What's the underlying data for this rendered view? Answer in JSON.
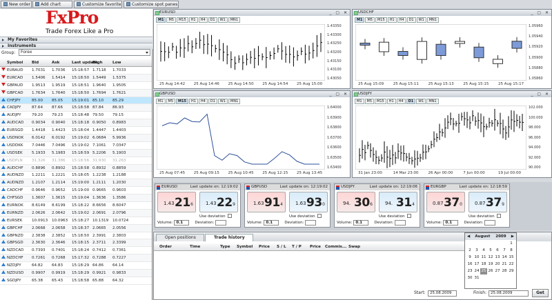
{
  "toolbar": {
    "buttons": [
      "New order",
      "Add chart",
      "Customize favorites",
      "Customize spot panes"
    ]
  },
  "brand": {
    "logo": "FxPro",
    "tagline": "Trade Forex Like a Pro"
  },
  "sidebar": {
    "favorites": "My Favorites",
    "instruments": "Instruments",
    "group_label": "Group:",
    "group_value": "Forex"
  },
  "market": {
    "headers": [
      "Symbol",
      "Bid",
      "Ask",
      "Last update",
      "High",
      "Low"
    ],
    "rows": [
      {
        "dir": "dn",
        "s": "EURAUD",
        "b": "1.7031",
        "a": "1.7036",
        "t": "15:18:57",
        "h": "1.7118",
        "l": "1.7033"
      },
      {
        "dir": "dn",
        "s": "EURCAD",
        "b": "1.5406",
        "a": "1.5414",
        "t": "15:18:50",
        "h": "1.5449",
        "l": "1.5375"
      },
      {
        "dir": "dn",
        "s": "GBPAUD",
        "b": "1.9513",
        "a": "1.9519",
        "t": "15:18:51",
        "h": "1.9640",
        "l": "1.9505"
      },
      {
        "dir": "dn",
        "s": "GBPCAD",
        "b": "1.7634",
        "a": "1.7640",
        "t": "15:18:50",
        "h": "1.7694",
        "l": "1.7621"
      },
      {
        "dir": "up",
        "s": "CHFJPY",
        "b": "85.00",
        "a": "85.05",
        "t": "15:19:01",
        "h": "85.10",
        "l": "85.29",
        "sel": true
      },
      {
        "dir": "up",
        "s": "CADJPY",
        "b": "87.64",
        "a": "87.66",
        "t": "15:18:58",
        "h": "87.84",
        "l": "86.93"
      },
      {
        "dir": "up",
        "s": "AUDJPY",
        "b": "79.20",
        "a": "79.23",
        "t": "15:18:48",
        "h": "79.50",
        "l": "79.15"
      },
      {
        "dir": "up",
        "s": "AUDCAD",
        "b": "0.9034",
        "a": "0.9040",
        "t": "15:18:18",
        "h": "0.9050",
        "l": "0.8983"
      },
      {
        "dir": "up",
        "s": "EURSGD",
        "b": "1.4418",
        "a": "1.4423",
        "t": "15:18:04",
        "h": "1.4447",
        "l": "1.4403"
      },
      {
        "dir": "up",
        "s": "USDNOK",
        "b": "6.0142",
        "a": "6.0192",
        "t": "15:19:02",
        "h": "6.0684",
        "l": "5.9936"
      },
      {
        "dir": "up",
        "s": "USDDKK",
        "b": "7.0446",
        "a": "7.0496",
        "t": "15:19:02",
        "h": "7.1061",
        "l": "7.0347"
      },
      {
        "dir": "up",
        "s": "USDSEK",
        "b": "5.1933",
        "a": "5.1983",
        "t": "15:18:59",
        "h": "5.2206",
        "l": "5.1903"
      },
      {
        "dir": "up",
        "s": "USDPLN",
        "b": "31.326",
        "a": "31.386",
        "t": "15:18:56",
        "h": "31.930",
        "l": "31.263",
        "dim": true
      },
      {
        "dir": "up",
        "s": "AUDCHF",
        "b": "0.8896",
        "a": "0.8902",
        "t": "15:18:58",
        "h": "0.8932",
        "l": "0.8859"
      },
      {
        "dir": "up",
        "s": "AUDNZD",
        "b": "1.2211",
        "a": "1.2221",
        "t": "15:18:05",
        "h": "1.2238",
        "l": "1.2188"
      },
      {
        "dir": "up",
        "s": "AUDNZD",
        "b": "1.2107",
        "a": "1.2114",
        "t": "15:19:00",
        "h": "1.2111",
        "l": "1.2030"
      },
      {
        "dir": "up",
        "s": "CADCHF",
        "b": "0.9646",
        "a": "0.9652",
        "t": "15:19:00",
        "h": "0.9665",
        "l": "0.9603"
      },
      {
        "dir": "up",
        "s": "CHFSGD",
        "b": "1.3607",
        "a": "1.3615",
        "t": "15:19:04",
        "h": "1.3636",
        "l": "1.3586"
      },
      {
        "dir": "up",
        "s": "EURNOK",
        "b": "8.6149",
        "a": "8.6199",
        "t": "15:18:22",
        "h": "8.6656",
        "l": "8.6047"
      },
      {
        "dir": "up",
        "s": "EURNZD",
        "b": "2.0626",
        "a": "2.0642",
        "t": "15:19:02",
        "h": "2.0691",
        "l": "2.0796"
      },
      {
        "dir": "up",
        "s": "EURSEK",
        "b": "10.0913",
        "a": "10.0963",
        "t": "15:18:27",
        "h": "10.1319",
        "l": "10.0724"
      },
      {
        "dir": "up",
        "s": "GBPCHF",
        "b": "2.0668",
        "a": "2.0658",
        "t": "15:18:37",
        "h": "2.0665",
        "l": "2.0556"
      },
      {
        "dir": "up",
        "s": "GBPNZD",
        "b": "2.3838",
        "a": "2.3852",
        "t": "15:18:50",
        "h": "2.3991",
        "l": "2.3803"
      },
      {
        "dir": "up",
        "s": "GBPSGD",
        "b": "2.3630",
        "a": "2.3646",
        "t": "15:18:15",
        "h": "2.3711",
        "l": "2.3399"
      },
      {
        "dir": "up",
        "s": "NZDCAD",
        "b": "0.7393",
        "a": "0.7401",
        "t": "15:18:24",
        "h": "0.7412",
        "l": "0.7361"
      },
      {
        "dir": "up",
        "s": "NZDCHF",
        "b": "0.7261",
        "a": "0.7268",
        "t": "15:17:32",
        "h": "0.7288",
        "l": "0.7227"
      },
      {
        "dir": "up",
        "s": "NZDJPY",
        "b": "64.82",
        "a": "64.83",
        "t": "15:18:29",
        "h": "64.86",
        "l": "64.14"
      },
      {
        "dir": "up",
        "s": "NZDUSD",
        "b": "0.9907",
        "a": "0.9919",
        "t": "15:18:29",
        "h": "0.9921",
        "l": "0.9833"
      },
      {
        "dir": "up",
        "s": "SGDJPY",
        "b": "65.38",
        "a": "65.43",
        "t": "15:18:58",
        "h": "65.88",
        "l": "64.32"
      }
    ]
  },
  "charts": [
    {
      "title": "EURUSD",
      "tfs": [
        "M1",
        "M5",
        "M15",
        "H1",
        "H4",
        "D1",
        "W1",
        "MN1"
      ],
      "active": "M1",
      "x": [
        "25 Aug 14:42",
        "25 Aug 14:46",
        "25 Aug 14:50",
        "25 Aug 14:54",
        "25 Aug 15:00"
      ],
      "y": [
        "1.43350",
        "1.43300",
        "1.43250",
        "1.43200",
        "1.43150",
        "1.43100",
        "1.43050"
      ]
    },
    {
      "title": "USDCHF",
      "tfs": [
        "M1",
        "M5",
        "M15",
        "H1",
        "H4",
        "D1",
        "W1",
        "MN1"
      ],
      "active": "M1",
      "x": [
        "25 Aug 15:09",
        "25 Aug 15:11",
        "25 Aug 15:13",
        "25 Aug 15:15",
        "25 Aug 15:17"
      ],
      "y": [
        "1.05960",
        "1.05940",
        "1.05920",
        "1.05900",
        "1.05880",
        "1.05860"
      ]
    },
    {
      "title": "GBPUSD",
      "tfs": [
        "M1",
        "M5",
        "M15",
        "H1",
        "H4",
        "D1",
        "W1",
        "MN1"
      ],
      "active": "M15",
      "x": [
        "25 Aug 07:45",
        "25 Aug 09:15",
        "25 Aug 10:45",
        "25 Aug 12:15",
        "25 Aug 13:45"
      ],
      "y": [
        "1.64000",
        "1.63900",
        "1.63800",
        "1.63700",
        "1.63600",
        "1.63500",
        "1.63400"
      ]
    },
    {
      "title": "USDJPY",
      "tfs": [
        "M1",
        "M5",
        "M15",
        "H1",
        "H4",
        "D1",
        "W1",
        "MN1"
      ],
      "active": "D1",
      "x": [
        "31 Jan 23:00",
        "14 Mar 23:00",
        "26 Apr 00:00",
        "7 Jun 00:00",
        "19 Jul 00:00"
      ],
      "y": [
        "102.000",
        "100.000",
        "98.000",
        "96.000",
        "94.000",
        "92.000",
        "90.000"
      ]
    }
  ],
  "quotes": [
    {
      "sym": "EURUSD",
      "upd": "Last update on: 12:19:02",
      "sell": {
        "p1": "1.43",
        "p2": "21",
        "p3": "6"
      },
      "buy": {
        "p1": "1.43",
        "p2": "22",
        "p3": "9"
      },
      "vol": "0.1"
    },
    {
      "sym": "GBPUSD",
      "upd": "Last update on: 12:19:02",
      "sell": {
        "p1": "1.63",
        "p2": "91",
        "p3": "4"
      },
      "buy": {
        "p1": "1.63",
        "p2": "93",
        "p3": "0"
      },
      "vol": "0.1"
    },
    {
      "sym": "USDJPY",
      "upd": "Last update on: 12:19:06",
      "sell": {
        "p1": "94.",
        "p2": "30",
        "p3": "6"
      },
      "buy": {
        "p1": "94.",
        "p2": "31",
        "p3": "4"
      },
      "vol": "0.1"
    },
    {
      "sym": "EURGBP",
      "upd": "Last update on: 12:18:59",
      "sell": {
        "p1": "0.87",
        "p2": "37",
        "p3": "0"
      },
      "buy": {
        "p1": "0.87",
        "p2": "37",
        "p3": "9"
      },
      "vol": "0.1"
    }
  ],
  "quote_labels": {
    "use_dev": "Use deviation",
    "volume": "Volume:",
    "deviation": "Deviation:"
  },
  "history": {
    "tabs": [
      "Open positions",
      "Trade history"
    ],
    "columns": [
      "Order",
      "Time",
      "Type",
      "Symbol",
      "Price",
      "S / L",
      "T / P",
      "Price",
      "Commis...",
      "Swap"
    ]
  },
  "calendar": {
    "month": "August",
    "year": "2009",
    "days": [
      "",
      "",
      "",
      "",
      "",
      "",
      "1",
      "2",
      "3",
      "4",
      "5",
      "6",
      "7",
      "8",
      "9",
      "10",
      "11",
      "12",
      "13",
      "14",
      "15",
      "16",
      "17",
      "18",
      "19",
      "20",
      "21",
      "22",
      "23",
      "24",
      "25",
      "26",
      "27",
      "28",
      "29",
      "30",
      "31"
    ],
    "selected": "25"
  },
  "range": {
    "start_label": "Start:",
    "start": "25.08.2009",
    "finish_label": "Finish:",
    "finish": "25.08.2009",
    "get": "Get"
  }
}
